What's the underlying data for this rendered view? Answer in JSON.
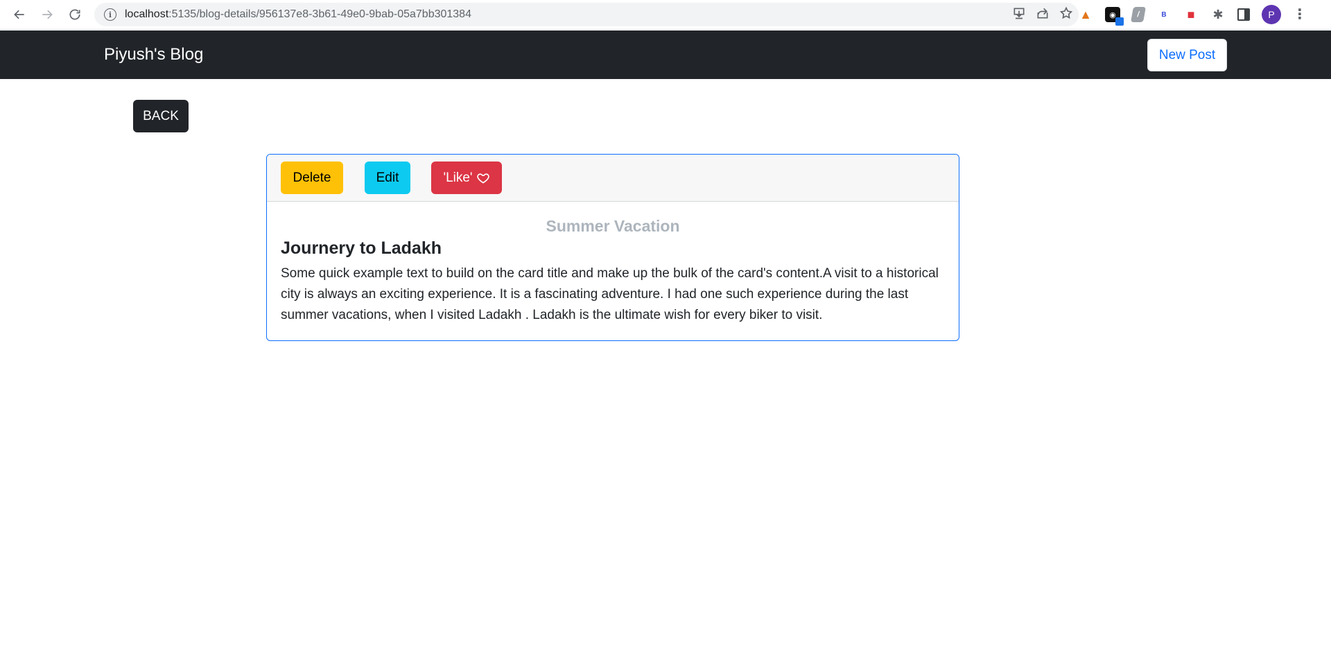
{
  "browser": {
    "url_host": "localhost",
    "url_path": ":5135/blog-details/956137e8-3b61-49e0-9bab-05a7bb301384",
    "avatar_letter": "P",
    "extension_b_label": "B"
  },
  "navbar": {
    "brand": "Piyush's Blog",
    "new_post_label": "New Post"
  },
  "back_label": "BACK",
  "card": {
    "delete_label": "Delete",
    "edit_label": "Edit",
    "like_label": "'Like'",
    "subtitle": "Summer Vacation",
    "title": "Journery to Ladakh",
    "text": "Some quick example text to build on the card title and make up the bulk of the card's content.A visit to a historical city is always an exciting experience. It is a fascinating adventure. I had one such experience during the last summer vacations, when I visited Ladakh . Ladakh is the ultimate wish for every biker to visit."
  },
  "colors": {
    "navbar_bg": "#212529",
    "delete_bg": "#ffc107",
    "edit_bg": "#0dcaf0",
    "like_bg": "#dc3545",
    "card_border": "#0d6efd",
    "link_blue": "#0d6efd"
  },
  "icons": {
    "back": "arrow-left-icon",
    "forward": "arrow-right-icon",
    "reload": "reload-icon",
    "site_info": "info-icon",
    "install": "install-icon",
    "share": "share-icon",
    "bookmark": "star-icon",
    "like": "heart-icon"
  }
}
